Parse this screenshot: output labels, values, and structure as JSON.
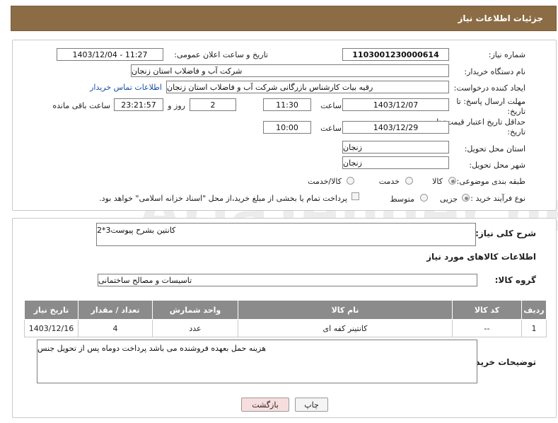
{
  "header": {
    "title": "جزئیات اطلاعات نیاز"
  },
  "form": {
    "need_number_label": "شماره نیاز:",
    "need_number": "1103001230000614",
    "announce_label": "تاریخ و ساعت اعلان عمومی:",
    "announce_value": "1403/12/04 - 11:27",
    "buyer_org_label": "نام دستگاه خریدار:",
    "buyer_org": "شرکت آب و فاضلاب استان زنجان",
    "creator_label": "ایجاد کننده درخواست:",
    "creator": "رقیه بیات کارشناس بازرگانی شرکت آب و فاضلاب استان زنجان",
    "contact_link": "اطلاعات تماس خریدار",
    "deadline_label": "مهلت ارسال پاسخ: تا تاریخ:",
    "deadline_date": "1403/12/07",
    "time_label": "ساعت",
    "deadline_time": "11:30",
    "days_value": "2",
    "days_label": "روز و",
    "remaining_time": "23:21:57",
    "remaining_label": "ساعت باقی مانده",
    "validity_label": "حداقل تاریخ اعتبار قیمت: تا تاریخ:",
    "validity_date": "1403/12/29",
    "validity_time_label": "ساعت",
    "validity_time": "10:00",
    "province_label": "استان محل تحویل:",
    "province": "زنجان",
    "city_label": "شهر محل تحویل:",
    "city": "زنجان",
    "category_label": "طبقه بندی موضوعی:",
    "category_options": [
      "کالا",
      "خدمت",
      "کالا/خدمت"
    ],
    "process_label": "نوع فرآیند خرید :",
    "process_options": [
      "جزیی",
      "متوسط"
    ],
    "payment_text": "پرداخت تمام یا بخشی از مبلغ خرید،از محل \"اسناد خزانه اسلامی\" خواهد بود."
  },
  "description": {
    "label": "شرح کلی نیاز:",
    "value": "کانتین بشرح پیوست3*2"
  },
  "goods": {
    "section_title": "اطلاعات کالاهای مورد نیاز",
    "group_label": "گروه کالا:",
    "group_value": "تاسیسات و مصالح ساختمانی"
  },
  "table": {
    "headers": [
      "ردیف",
      "کد کالا",
      "نام کالا",
      "واحد شمارش",
      "تعداد / مقدار",
      "تاریخ نیاز"
    ],
    "rows": [
      [
        "1",
        "--",
        "کانتینر کفه ای",
        "عدد",
        "4",
        "1403/12/16"
      ]
    ]
  },
  "buyer_notes": {
    "label": "توضیحات خریدار:",
    "value": "هزینه حمل بعهده فروشنده می باشد پرداخت دوماه پس از تحویل جنس"
  },
  "buttons": {
    "print": "چاپ",
    "back": "بازگشت"
  },
  "watermark": "AriaTender.neT",
  "colors": {
    "header_bg": "#8b6c45",
    "table_header_bg": "#8b8b8b",
    "back_button_bg": "#f7dede"
  }
}
